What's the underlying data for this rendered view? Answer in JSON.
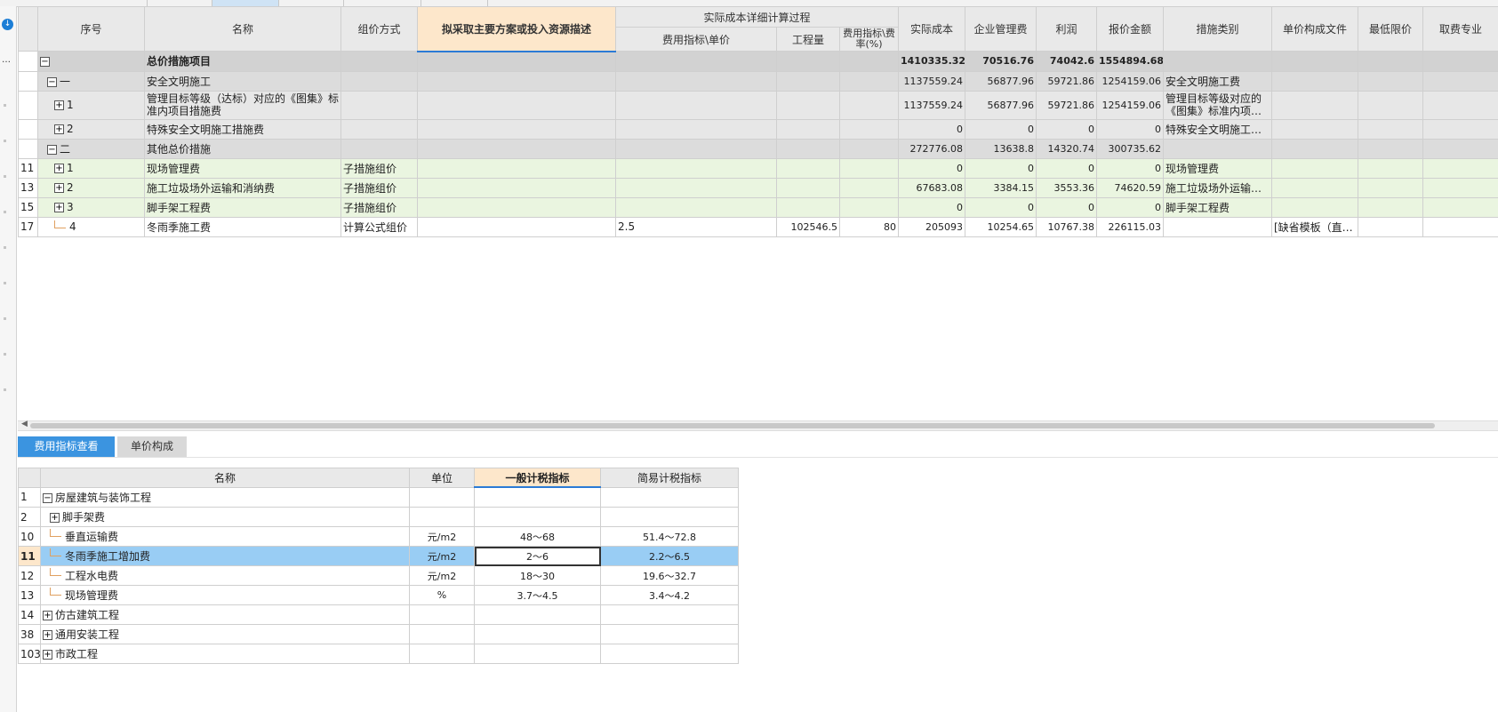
{
  "grid": {
    "headers": {
      "seq": "序号",
      "name": "名称",
      "pricing_method": "组价方式",
      "plan_desc": "拟采取主要方案或投入资源描述",
      "detail_group": "实际成本详细计算过程",
      "fee_index_unit": "费用指标\\单价",
      "quantity": "工程量",
      "fee_rate": "费用指标\\费率(%)",
      "actual_cost": "实际成本",
      "mgmt_fee": "企业管理费",
      "profit": "利润",
      "quote": "报价金额",
      "category": "措施类别",
      "unit_file": "单价构成文件",
      "min_price": "最低限价",
      "fee_major": "取费专业"
    },
    "rows": [
      {
        "num": "",
        "seq": "",
        "name": "总价措施项目",
        "method": "",
        "desc": "",
        "index": "",
        "qty": "",
        "rate": "",
        "cost": "1410335.32",
        "mgmt": "70516.76",
        "profit": "74042.6",
        "quote": "1554894.68",
        "cat": "",
        "file": "",
        "min": "",
        "major": ""
      },
      {
        "num": "",
        "seq": "一",
        "name": "安全文明施工",
        "method": "",
        "desc": "",
        "index": "",
        "qty": "",
        "rate": "",
        "cost": "1137559.24",
        "mgmt": "56877.96",
        "profit": "59721.86",
        "quote": "1254159.06",
        "cat": "安全文明施工费",
        "file": "",
        "min": "",
        "major": ""
      },
      {
        "num": "",
        "seq": "1",
        "name": "管理目标等级（达标）对应的《图集》标准内项目措施费",
        "method": "",
        "desc": "",
        "index": "",
        "qty": "",
        "rate": "",
        "cost": "1137559.24",
        "mgmt": "56877.96",
        "profit": "59721.86",
        "quote": "1254159.06",
        "cat": "管理目标等级对应的《图集》标准内项…",
        "file": "",
        "min": "",
        "major": ""
      },
      {
        "num": "",
        "seq": "2",
        "name": "特殊安全文明施工措施费",
        "method": "",
        "desc": "",
        "index": "",
        "qty": "",
        "rate": "",
        "cost": "0",
        "mgmt": "0",
        "profit": "0",
        "quote": "0",
        "cat": "特殊安全文明施工…",
        "file": "",
        "min": "",
        "major": ""
      },
      {
        "num": "",
        "seq": "二",
        "name": "其他总价措施",
        "method": "",
        "desc": "",
        "index": "",
        "qty": "",
        "rate": "",
        "cost": "272776.08",
        "mgmt": "13638.8",
        "profit": "14320.74",
        "quote": "300735.62",
        "cat": "",
        "file": "",
        "min": "",
        "major": ""
      },
      {
        "num": "11",
        "seq": "1",
        "name": "现场管理费",
        "method": "子措施组价",
        "desc": "",
        "index": "",
        "qty": "",
        "rate": "",
        "cost": "0",
        "mgmt": "0",
        "profit": "0",
        "quote": "0",
        "cat": "现场管理费",
        "file": "",
        "min": "",
        "major": ""
      },
      {
        "num": "13",
        "seq": "2",
        "name": "施工垃圾场外运输和消纳费",
        "method": "子措施组价",
        "desc": "",
        "index": "",
        "qty": "",
        "rate": "",
        "cost": "67683.08",
        "mgmt": "3384.15",
        "profit": "3553.36",
        "quote": "74620.59",
        "cat": "施工垃圾场外运输…",
        "file": "",
        "min": "",
        "major": ""
      },
      {
        "num": "15",
        "seq": "3",
        "name": "脚手架工程费",
        "method": "子措施组价",
        "desc": "",
        "index": "",
        "qty": "",
        "rate": "",
        "cost": "0",
        "mgmt": "0",
        "profit": "0",
        "quote": "0",
        "cat": "脚手架工程费",
        "file": "",
        "min": "",
        "major": ""
      },
      {
        "num": "17",
        "seq": "4",
        "name": "冬雨季施工费",
        "method": "计算公式组价",
        "desc": "",
        "index": "2.5",
        "qty": "102546.5",
        "rate": "80",
        "cost": "205093",
        "mgmt": "10254.65",
        "profit": "10767.38",
        "quote": "226115.03",
        "cat": "",
        "file": "[缺省模板（直…",
        "min": "",
        "major": ""
      }
    ]
  },
  "bottom_tabs": [
    "费用指标查看",
    "单价构成"
  ],
  "sub": {
    "headers": {
      "name": "名称",
      "unit": "单位",
      "general": "一般计税指标",
      "simple": "简易计税指标"
    },
    "rows": [
      {
        "num": "1",
        "name": "房屋建筑与装饰工程",
        "unit": "",
        "general": "",
        "simple": ""
      },
      {
        "num": "2",
        "name": "脚手架费",
        "unit": "",
        "general": "",
        "simple": ""
      },
      {
        "num": "10",
        "name": "垂直运输费",
        "unit": "元/m2",
        "general": "48～68",
        "simple": "51.4～72.8"
      },
      {
        "num": "11",
        "name": "冬雨季施工增加费",
        "unit": "元/m2",
        "general": "2～6",
        "simple": "2.2～6.5"
      },
      {
        "num": "12",
        "name": "工程水电费",
        "unit": "元/m2",
        "general": "18～30",
        "simple": "19.6～32.7"
      },
      {
        "num": "13",
        "name": "现场管理费",
        "unit": "%",
        "general": "3.7～4.5",
        "simple": "3.4～4.2"
      },
      {
        "num": "14",
        "name": "仿古建筑工程",
        "unit": "",
        "general": "",
        "simple": ""
      },
      {
        "num": "38",
        "name": "通用安装工程",
        "unit": "",
        "general": "",
        "simple": ""
      },
      {
        "num": "103",
        "name": "市政工程",
        "unit": "",
        "general": "",
        "simple": ""
      }
    ]
  },
  "icons": {
    "expand": "+",
    "collapse": "−",
    "nav": "↓",
    "left_arrow": "◀"
  },
  "colors": {
    "accent": "#3b94e0",
    "header_highlight": "#fde7cb",
    "selected_row": "#99cdf4",
    "green_row": "#eaf5e0"
  }
}
